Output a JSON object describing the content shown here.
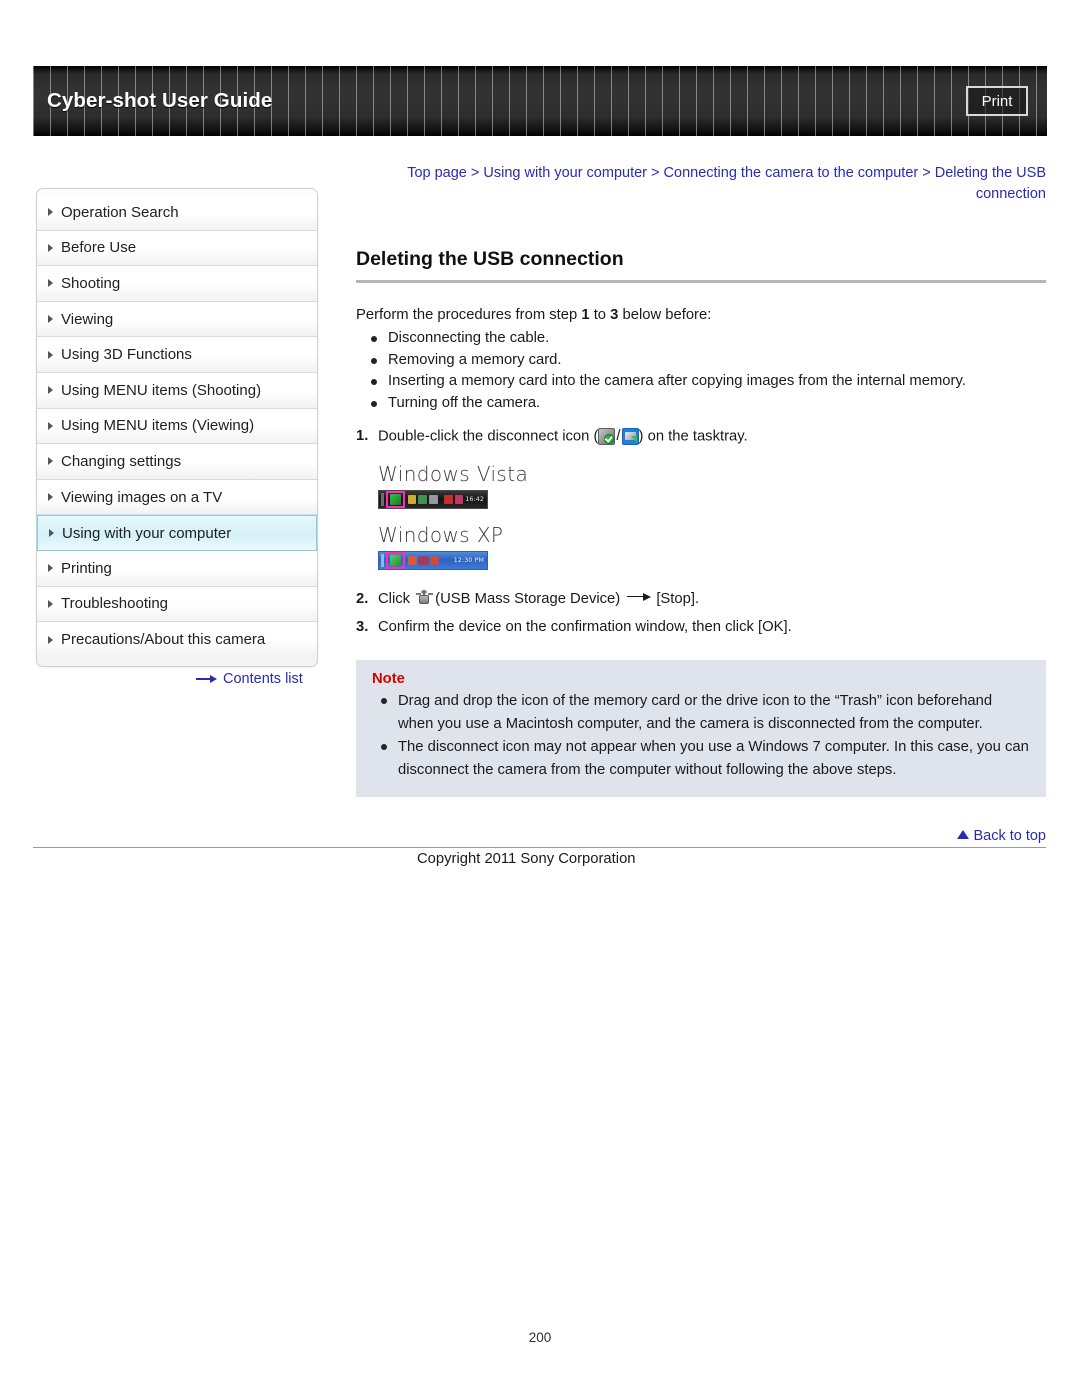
{
  "header": {
    "title": "Cyber-shot User Guide",
    "print_label": "Print"
  },
  "breadcrumb": {
    "items": [
      "Top page",
      "Using with your computer",
      "Connecting the camera to the computer",
      "Deleting the USB connection"
    ],
    "separator": ">"
  },
  "sidebar": {
    "items": [
      {
        "label": "Operation Search",
        "active": false
      },
      {
        "label": "Before Use",
        "active": false
      },
      {
        "label": "Shooting",
        "active": false
      },
      {
        "label": "Viewing",
        "active": false
      },
      {
        "label": "Using 3D Functions",
        "active": false
      },
      {
        "label": "Using MENU items (Shooting)",
        "active": false
      },
      {
        "label": "Using MENU items (Viewing)",
        "active": false
      },
      {
        "label": "Changing settings",
        "active": false
      },
      {
        "label": "Viewing images on a TV",
        "active": false
      },
      {
        "label": "Using with your computer",
        "active": true
      },
      {
        "label": "Printing",
        "active": false
      },
      {
        "label": "Troubleshooting",
        "active": false
      },
      {
        "label": "Precautions/About this camera",
        "active": false
      }
    ],
    "contents_link": "Contents list"
  },
  "main": {
    "title": "Deleting the USB connection",
    "intro_prefix": "Perform the procedures from step ",
    "intro_step_from": "1",
    "intro_mid": " to ",
    "intro_step_to": "3",
    "intro_suffix": " below before:",
    "before_list": [
      "Disconnecting the cable.",
      "Removing a memory card.",
      "Inserting a memory card into the camera after copying images from the internal memory.",
      "Turning off the camera."
    ],
    "steps": [
      {
        "num": "1.",
        "text_before_icons": "Double-click the disconnect icon (",
        "text_after_icons": ") on the tasktray."
      },
      {
        "num": "2.",
        "text_before_icon": "Click ",
        "text_after_icon": "(USB Mass Storage Device) ",
        "text_tail": "[Stop]."
      },
      {
        "num": "3.",
        "text": "Confirm the device on the confirmation window, then click [OK]."
      }
    ],
    "os_images": [
      {
        "label": "Windows Vista",
        "clock": "16:42"
      },
      {
        "label": "Windows XP",
        "clock": "12:30 PM"
      }
    ],
    "note": {
      "title": "Note",
      "items": [
        "Drag and drop the icon of the memory card or the drive icon to the “Trash” icon beforehand when you use a Macintosh computer, and the camera is disconnected from the computer.",
        "The disconnect icon may not appear when you use a Windows 7 computer. In this case, you can disconnect the camera from the computer without following the above steps."
      ]
    }
  },
  "footer": {
    "back_to_top": "Back to top",
    "copyright": "Copyright 2011 Sony Corporation",
    "page_number": "200"
  },
  "colors": {
    "link": "#2b2bb0",
    "note_bg": "#dfe4ec",
    "note_title": "#d60000",
    "active_nav": "#d4f1f8",
    "highlight_box": "#ff2db2"
  }
}
